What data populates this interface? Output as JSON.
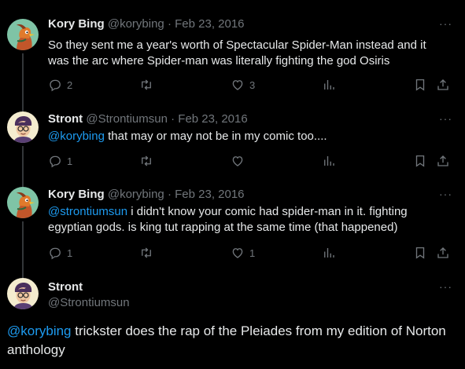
{
  "tweets": [
    {
      "name": "Kory Bing",
      "handle": "@korybing",
      "date": "Feb 23, 2016",
      "text": "So they sent me a year's worth of Spectacular Spider-Man instead and it was the arc where Spider-man was literally fighting the god Osiris",
      "replies": "2",
      "retweets": "",
      "likes": "3"
    },
    {
      "name": "Stront",
      "handle": "@Strontiumsun",
      "date": "Feb 23, 2016",
      "mention": "@korybing",
      "text": " that may or may not be in my comic too....",
      "replies": "1",
      "retweets": "",
      "likes": ""
    },
    {
      "name": "Kory Bing",
      "handle": "@korybing",
      "date": "Feb 23, 2016",
      "mention": "@strontiumsun",
      "text": " i didn't know your comic had spider-man in it. fighting egyptian gods. is king tut rapping at the same time (that happened)",
      "replies": "1",
      "retweets": "",
      "likes": "1"
    }
  ],
  "main_tweet": {
    "name": "Stront",
    "handle": "@Strontiumsun",
    "mention": "@korybing",
    "text": " trickster does the rap of the Pleiades from my edition of Norton anthology"
  },
  "more_label": "···",
  "date_separator": "·",
  "colors": {
    "accent": "#1d9bf0",
    "muted": "#71767b",
    "background": "#000000"
  }
}
